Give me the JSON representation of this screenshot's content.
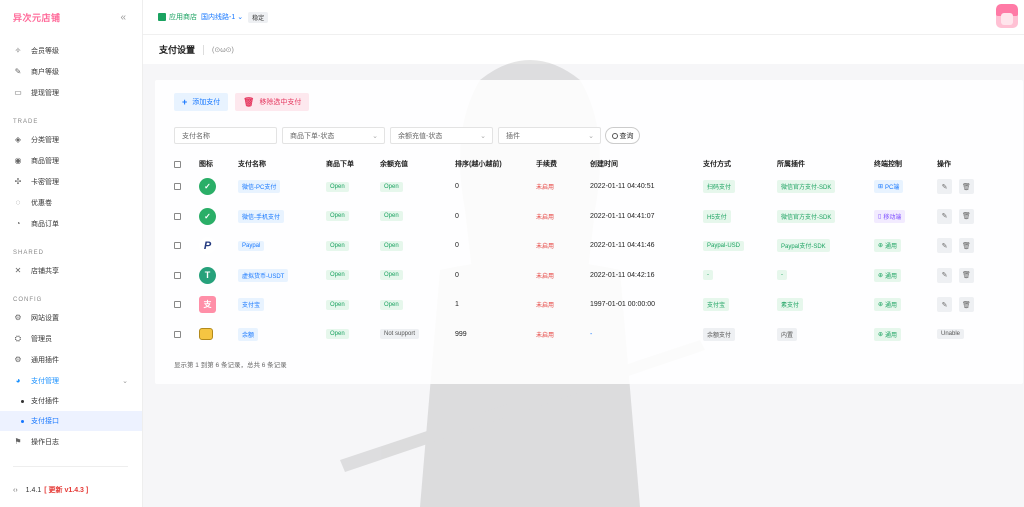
{
  "sidebar": {
    "brand": "异次元店铺",
    "items_top": [
      {
        "label": "会员等级",
        "icon": "user-group-icon"
      },
      {
        "label": "商户等级",
        "icon": "merchant-icon"
      },
      {
        "label": "提现管理",
        "icon": "withdraw-icon"
      }
    ],
    "section_trade": "TRADE",
    "items_trade": [
      {
        "label": "分类管理",
        "icon": "category-icon"
      },
      {
        "label": "商品管理",
        "icon": "goods-icon"
      },
      {
        "label": "卡密管理",
        "icon": "card-icon"
      },
      {
        "label": "优惠卷",
        "icon": "coupon-icon"
      },
      {
        "label": "商品订单",
        "icon": "order-icon"
      }
    ],
    "section_shared": "SHARED",
    "items_shared": [
      {
        "label": "店铺共享",
        "icon": "share-icon"
      }
    ],
    "section_config": "CONFIG",
    "items_config": [
      {
        "label": "网站设置",
        "icon": "settings-icon"
      },
      {
        "label": "管理员",
        "icon": "admin-icon"
      },
      {
        "label": "通用插件",
        "icon": "plugin-icon"
      },
      {
        "label": "支付管理",
        "icon": "payment-icon"
      }
    ],
    "sub_items": [
      {
        "label": "支付插件"
      },
      {
        "label": "支付接口"
      }
    ],
    "log_item": {
      "label": "操作日志",
      "icon": "log-icon"
    },
    "version": "1.4.1",
    "update_label": "[ 更新 v1.4.3 ]"
  },
  "topbar": {
    "store_label": "应用商店",
    "line_label": "国内线路-1",
    "stable_badge": "稳定"
  },
  "titlebar": {
    "title": "支付设置",
    "kaomoji": "(⊙ω⊙)"
  },
  "toolbar": {
    "add_label": "添加支付",
    "delete_label": "移除选中支付"
  },
  "filters": {
    "name_placeholder": "支付名称",
    "order_status": "商品下单-状态",
    "balance_status": "余额充值-状态",
    "plugin": "插件",
    "search_label": "查询"
  },
  "table": {
    "headers": [
      "图标",
      "支付名称",
      "商品下单",
      "余额充值",
      "排序(越小越前)",
      "手续费",
      "创建时间",
      "支付方式",
      "所属插件",
      "终端控制",
      "操作"
    ],
    "rows": [
      {
        "icon": "wechat-icon",
        "name": "微信-PC支付",
        "order": "Open",
        "balance": "Open",
        "sort": "0",
        "fee": "未启用",
        "time": "2022-01-11 04:40:51",
        "method": "扫码支付",
        "plugin": "微信官方支付-SDK",
        "terminal": "PC端",
        "terminal_type": "blue",
        "terminal_icon": "windows-icon"
      },
      {
        "icon": "wechat-icon",
        "name": "微信-手机支付",
        "order": "Open",
        "balance": "Open",
        "sort": "0",
        "fee": "未启用",
        "time": "2022-01-11 04:41:07",
        "method": "H5支付",
        "plugin": "微信官方支付-SDK",
        "terminal": "移动端",
        "terminal_type": "purple",
        "terminal_icon": "mobile-icon"
      },
      {
        "icon": "paypal-icon",
        "name": "Paypal",
        "order": "Open",
        "balance": "Open",
        "sort": "0",
        "fee": "未启用",
        "time": "2022-01-11 04:41:46",
        "method": "Paypal-USD",
        "plugin": "Paypal支付-SDK",
        "terminal": "通用",
        "terminal_type": "green",
        "terminal_icon": "globe-icon"
      },
      {
        "icon": "usdt-icon",
        "name": "虚拟货币-USDT",
        "order": "Open",
        "balance": "Open",
        "sort": "0",
        "fee": "未启用",
        "time": "2022-01-11 04:42:16",
        "method": "-",
        "plugin": "-",
        "terminal": "通用",
        "terminal_type": "green",
        "terminal_icon": "globe-icon"
      },
      {
        "icon": "alipay-icon",
        "name": "支付宝",
        "order": "Open",
        "balance": "Open",
        "sort": "1",
        "fee": "未启用",
        "time": "1997-01-01 00:00:00",
        "method": "支付宝",
        "plugin": "素支付",
        "terminal": "通用",
        "terminal_type": "green",
        "terminal_icon": "globe-icon"
      },
      {
        "icon": "balance-icon",
        "name": "余额",
        "order": "Open",
        "balance": "Not support",
        "sort": "999",
        "fee": "未启用",
        "time": "-",
        "method": "余额支付",
        "plugin": "内置",
        "terminal": "通用",
        "terminal_type": "green",
        "terminal_icon": "globe-icon",
        "actions_label": "Unable"
      }
    ]
  },
  "footer_note": "显示第 1 到第 6 条记录，总共 6 条记录"
}
